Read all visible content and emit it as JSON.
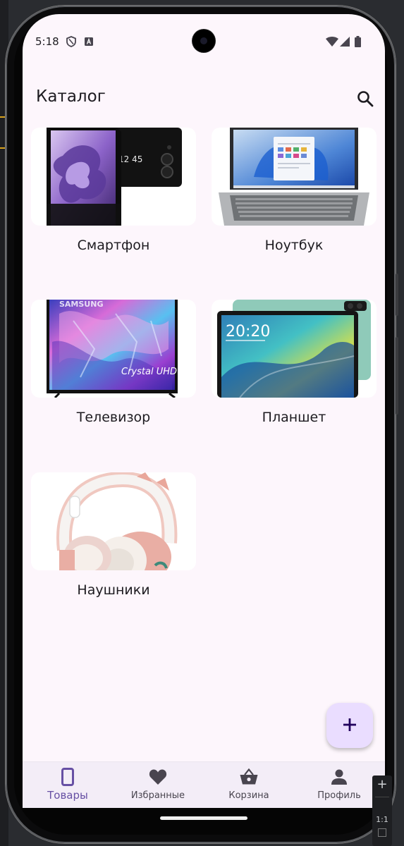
{
  "status_bar": {
    "time": "5:18"
  },
  "app_bar": {
    "title": "Каталог"
  },
  "products": [
    {
      "label": "Смартфон"
    },
    {
      "label": "Ноутбук"
    },
    {
      "label": "Телевизор"
    },
    {
      "label": "Планшет"
    },
    {
      "label": "Наушники"
    }
  ],
  "tv_brand": "SAMSUNG",
  "tv_caption": "Crystal UHD",
  "phone_clock": "12 45",
  "tablet_clock": "20:20",
  "nav": {
    "items": [
      {
        "label": "Товары",
        "icon": "smartphone-icon"
      },
      {
        "label": "Избранные",
        "icon": "heart-icon"
      },
      {
        "label": "Корзина",
        "icon": "shopping-basket-icon"
      },
      {
        "label": "Профиль",
        "icon": "person-icon"
      }
    ]
  },
  "zoom": {
    "label": "1:1"
  },
  "colors": {
    "background": "#fdf6fc",
    "accent": "#6750a4",
    "fab": "#eaddff",
    "navbar": "#f3edf7"
  }
}
